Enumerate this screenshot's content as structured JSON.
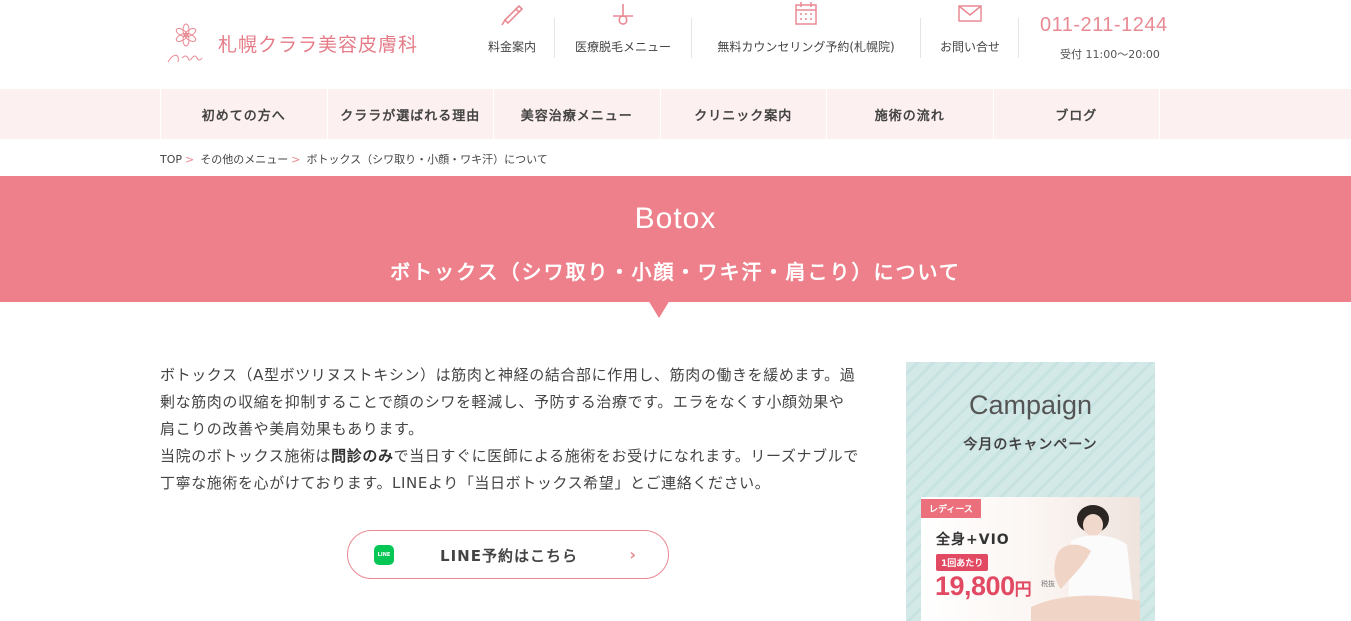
{
  "header": {
    "logo_text": "札幌クララ美容皮膚科",
    "logo_script": "Clara",
    "nav": [
      {
        "label": "料金案内",
        "icon": "pen-icon"
      },
      {
        "label": "医療脱毛メニュー",
        "icon": "hair-removal-icon"
      },
      {
        "label": "無料カウンセリング予約(札幌院)",
        "icon": "calendar-icon"
      },
      {
        "label": "お問い合せ",
        "icon": "mail-icon"
      }
    ],
    "tel": "011-211-1244",
    "hours": "受付 11:00〜20:00"
  },
  "gnav": {
    "items": [
      "初めての方へ",
      "クララが選ばれる理由",
      "美容治療メニュー",
      "クリニック案内",
      "施術の流れ",
      "ブログ"
    ]
  },
  "breadcrumb": {
    "items": [
      "TOP",
      "その他のメニュー",
      "ボトックス（シワ取り・小顔・ワキ汗）について"
    ]
  },
  "hero": {
    "title_en": "Botox",
    "title_ja": "ボトックス（シワ取り・小顔・ワキ汗・肩こり）について"
  },
  "intro": {
    "line1": "ボトックス（A型ボツリヌストキシン）は筋肉と神経の結合部に作用し、筋肉の働きを緩めます。過剰な筋肉の収縮を抑制することで顔のシワを軽減し、予防する治療です。エラをなくす小顔効果や肩こりの改善や美肩効果もあります。",
    "line2_pre": "当院のボトックス施術は",
    "line2_bold": "問診のみ",
    "line2_post": "で当日すぐに医師による施術をお受けになれます。リーズナブルで丁寧な施術を心がけております。LINEより「当日ボトックス希望」とご連絡ください。"
  },
  "line_button": {
    "label": "LINE予約はこちら",
    "icon_text": "LINE",
    "chevron": "›"
  },
  "campaign": {
    "title_en": "Campaign",
    "title_ja": "今月のキャンペーン",
    "tag": "レディース",
    "course": "全身+VIO",
    "per": "1回あたり",
    "price": "19,800",
    "price_unit": "円",
    "tax": "税抜"
  },
  "colors": {
    "accent": "#ed808a",
    "nav_bg": "#fdf0f0",
    "campaign_bg": "#d3e9e8",
    "price": "#e14a62",
    "line_green": "#06c755"
  }
}
